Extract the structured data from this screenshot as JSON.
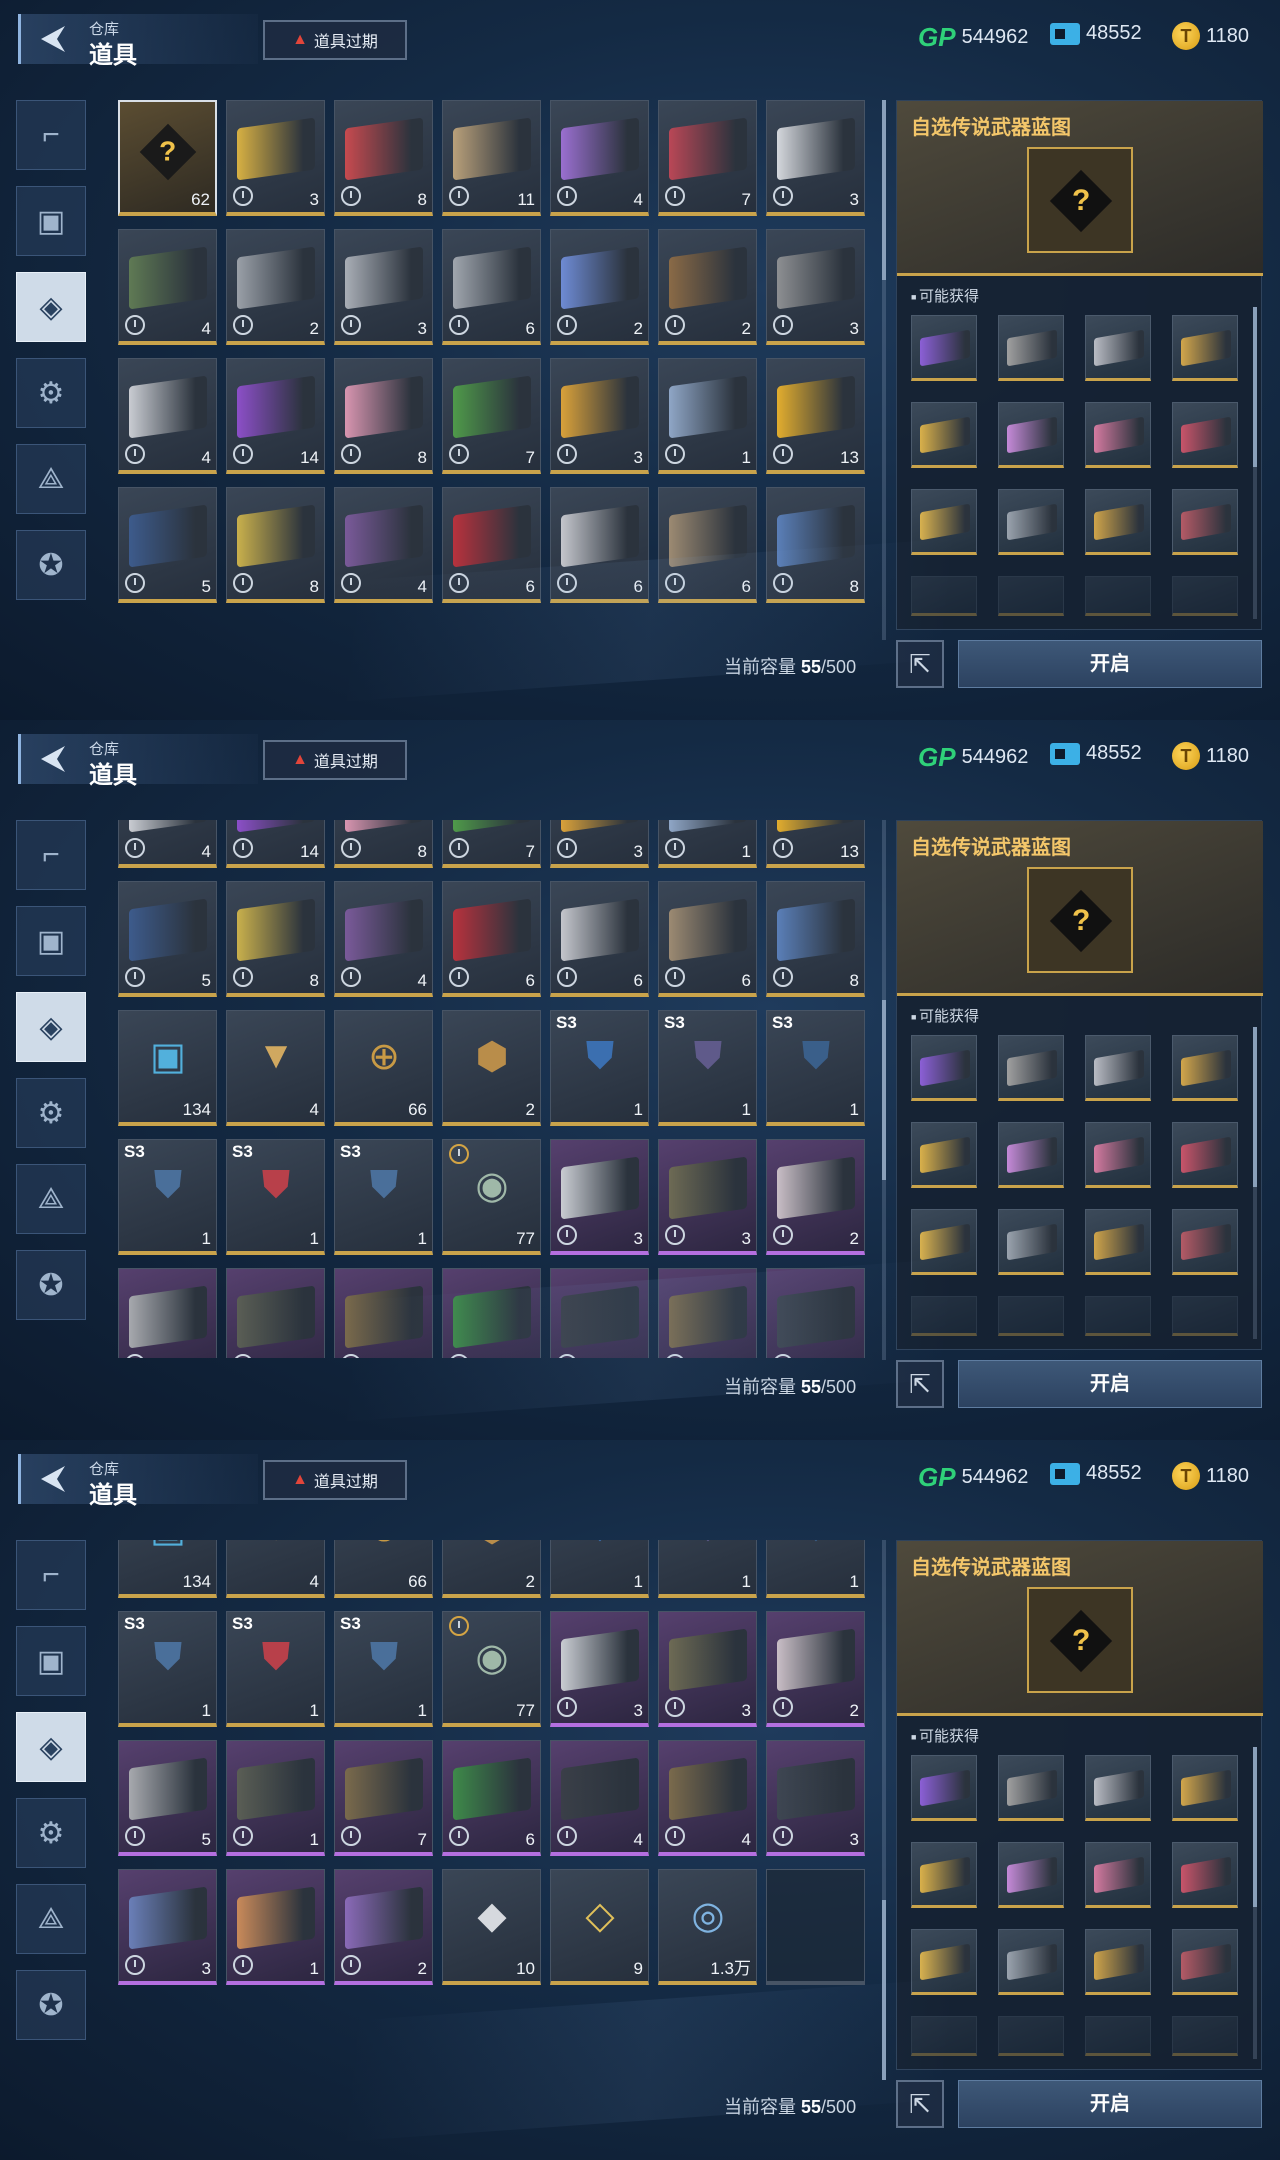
{
  "header": {
    "breadcrumb_parent": "仓库",
    "page_title": "道具",
    "alert_label": "道具过期",
    "currencies": [
      {
        "icon": "gp-icon",
        "label": "GP",
        "value": "544962"
      },
      {
        "icon": "ticket-card-icon",
        "value": "48552"
      },
      {
        "icon": "coin-icon",
        "label": "T",
        "value": "1180"
      }
    ]
  },
  "sidebar": {
    "items": [
      {
        "icon": "pistol-icon",
        "label": "weapons"
      },
      {
        "icon": "frame-icon",
        "label": "skins"
      },
      {
        "icon": "dogtag-icon",
        "label": "items",
        "active": true
      },
      {
        "icon": "attachment-icon",
        "label": "attachments"
      },
      {
        "icon": "blueprint-compass-icon",
        "label": "blueprints"
      },
      {
        "icon": "star-badge-icon",
        "label": "badges"
      }
    ]
  },
  "capacity": {
    "label": "当前容量",
    "value": "55",
    "max": "/500"
  },
  "detail": {
    "title": "自选传说武器蓝图",
    "section_label": "可能获得",
    "open_button": "开启",
    "rewards": [
      "#8b5fd6",
      "#a0a0a0",
      "#b9bcc4",
      "#d2a64b",
      "#d9b04a",
      "#c58ad8",
      "#d47aa0",
      "#c8546a",
      "#d8b14f",
      "#9aa3ae",
      "#cfa44a",
      "#b45a66"
    ]
  },
  "frames": [
    {
      "rows": [
        [
          {
            "c": "62",
            "sel": true,
            "q": true
          },
          {
            "c": "3",
            "col": "#d7b043"
          },
          {
            "c": "8",
            "col": "#c74a4f"
          },
          {
            "c": "11",
            "col": "#b9a07a"
          },
          {
            "c": "4",
            "col": "#9a6fd0"
          },
          {
            "c": "7",
            "col": "#b94756"
          },
          {
            "c": "3",
            "col": "#d4d7dc"
          }
        ],
        [
          {
            "c": "4",
            "col": "#5f7a54"
          },
          {
            "c": "2",
            "col": "#9aa0a8"
          },
          {
            "c": "3",
            "col": "#a9aeb6"
          },
          {
            "c": "6",
            "col": "#a0a6ae"
          },
          {
            "c": "2",
            "col": "#6e8bd4"
          },
          {
            "c": "2",
            "col": "#8a6a46"
          },
          {
            "c": "3",
            "col": "#8d8f92"
          }
        ],
        [
          {
            "c": "4",
            "col": "#c9ccd2"
          },
          {
            "c": "14",
            "col": "#8c4fc8"
          },
          {
            "c": "8",
            "col": "#d895b0"
          },
          {
            "c": "7",
            "col": "#4f9a4a"
          },
          {
            "c": "3",
            "col": "#d9a13a"
          },
          {
            "c": "1",
            "col": "#8fa6c6"
          },
          {
            "c": "13",
            "col": "#e2ad2e"
          }
        ],
        [
          {
            "c": "5",
            "col": "#3d5b8c"
          },
          {
            "c": "8",
            "col": "#c9b04c"
          },
          {
            "c": "4",
            "col": "#7a5a9a"
          },
          {
            "c": "6",
            "col": "#b8323d"
          },
          {
            "c": "6",
            "col": "#c4c6cc"
          },
          {
            "c": "6",
            "col": "#9c8a72"
          },
          {
            "c": "8",
            "col": "#5a7fb8"
          }
        ]
      ]
    },
    {
      "rows": [
        [
          {
            "c": "4",
            "col": "#c9ccd2"
          },
          {
            "c": "14",
            "col": "#8c4fc8"
          },
          {
            "c": "8",
            "col": "#d895b0"
          },
          {
            "c": "7",
            "col": "#4f9a4a"
          },
          {
            "c": "3",
            "col": "#d9a13a"
          },
          {
            "c": "1",
            "col": "#8fa6c6"
          },
          {
            "c": "13",
            "col": "#e2ad2e"
          }
        ],
        [
          {
            "c": "5",
            "col": "#3d5b8c"
          },
          {
            "c": "8",
            "col": "#c9b04c"
          },
          {
            "c": "4",
            "col": "#7a5a9a"
          },
          {
            "c": "6",
            "col": "#b8323d"
          },
          {
            "c": "6",
            "col": "#c4c6cc"
          },
          {
            "c": "6",
            "col": "#9c8a72"
          },
          {
            "c": "8",
            "col": "#5a7fb8"
          }
        ],
        [
          {
            "c": "134",
            "kind": "chip"
          },
          {
            "c": "4",
            "kind": "tri"
          },
          {
            "c": "66",
            "kind": "medal"
          },
          {
            "c": "2",
            "kind": "hex"
          },
          {
            "c": "1",
            "tag": "S3",
            "kind": "pack",
            "col": "#3b6fb0"
          },
          {
            "c": "1",
            "tag": "S3",
            "kind": "pack",
            "col": "#5f5a8a"
          },
          {
            "c": "1",
            "tag": "S3",
            "kind": "pack",
            "col": "#3a5f8a"
          }
        ],
        [
          {
            "c": "1",
            "tag": "S3",
            "kind": "pack",
            "col": "#4a6f9a"
          },
          {
            "c": "1",
            "tag": "S3",
            "kind": "pack",
            "col": "#b8404a"
          },
          {
            "c": "1",
            "tag": "S3",
            "kind": "pack",
            "col": "#4a6f9a"
          },
          {
            "c": "77",
            "kind": "emblem",
            "timer": true
          },
          {
            "c": "3",
            "col": "#c9ccd2",
            "purple": true
          },
          {
            "c": "3",
            "col": "#6d6a54",
            "purple": true
          },
          {
            "c": "2",
            "col": "#c9bec6",
            "purple": true
          }
        ],
        [
          {
            "c": "",
            "col": "#a7a9ae",
            "purple": true
          },
          {
            "c": "",
            "col": "#5a5e55",
            "purple": true
          },
          {
            "c": "",
            "col": "#7a6a4c",
            "purple": true
          },
          {
            "c": "",
            "col": "#3e8a4a",
            "purple": true
          },
          {
            "c": "",
            "col": "#3a3f48",
            "purple": true
          },
          {
            "c": "",
            "col": "#7a6a4c",
            "purple": true
          },
          {
            "c": "",
            "col": "#3e4652",
            "purple": true
          }
        ]
      ]
    },
    {
      "rows": [
        [
          {
            "c": "134",
            "kind": "chip"
          },
          {
            "c": "4",
            "kind": "tri"
          },
          {
            "c": "66",
            "kind": "medal"
          },
          {
            "c": "2",
            "kind": "hex"
          },
          {
            "c": "1",
            "tag": "S3",
            "kind": "pack",
            "col": "#3b6fb0"
          },
          {
            "c": "1",
            "tag": "S3",
            "kind": "pack",
            "col": "#5f5a8a"
          },
          {
            "c": "1",
            "tag": "S3",
            "kind": "pack",
            "col": "#3a5f8a"
          }
        ],
        [
          {
            "c": "1",
            "tag": "S3",
            "kind": "pack",
            "col": "#4a6f9a"
          },
          {
            "c": "1",
            "tag": "S3",
            "kind": "pack",
            "col": "#b8404a"
          },
          {
            "c": "1",
            "tag": "S3",
            "kind": "pack",
            "col": "#4a6f9a"
          },
          {
            "c": "77",
            "kind": "emblem",
            "timer": true
          },
          {
            "c": "3",
            "col": "#c9ccd2",
            "purple": true
          },
          {
            "c": "3",
            "col": "#6d6a54",
            "purple": true
          },
          {
            "c": "2",
            "col": "#c9bec6",
            "purple": true
          }
        ],
        [
          {
            "c": "5",
            "col": "#a7a9ae",
            "purple": true
          },
          {
            "c": "1",
            "col": "#5a5e55",
            "purple": true
          },
          {
            "c": "7",
            "col": "#7a6a4c",
            "purple": true
          },
          {
            "c": "6",
            "col": "#3e8a4a",
            "purple": true
          },
          {
            "c": "4",
            "col": "#3a3f48",
            "purple": true
          },
          {
            "c": "4",
            "col": "#7a6a4c",
            "purple": true
          },
          {
            "c": "3",
            "col": "#3e4652",
            "purple": true
          }
        ],
        [
          {
            "c": "3",
            "col": "#6a7fb8",
            "purple": true
          },
          {
            "c": "1",
            "col": "#c98a5a",
            "purple": true
          },
          {
            "c": "2",
            "col": "#8a6ab8",
            "purple": true
          },
          {
            "c": "10",
            "kind": "card"
          },
          {
            "c": "9",
            "kind": "card2"
          },
          {
            "c": "1.3万",
            "kind": "ring"
          },
          {
            "empty": true
          }
        ]
      ]
    }
  ]
}
